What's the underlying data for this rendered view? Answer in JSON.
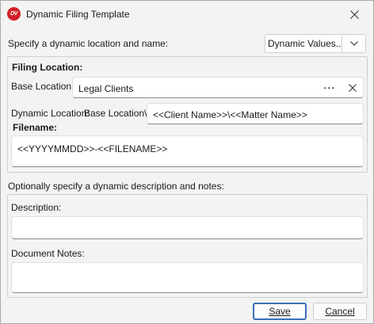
{
  "window": {
    "title": "Dynamic Filing Template",
    "logo_text": "DV"
  },
  "prompt_location": "Specify a dynamic location and name:",
  "dynamic_values": {
    "label": "Dynamic Values...."
  },
  "filing": {
    "heading": "Filing Location:",
    "base_location_label": "Base Location:",
    "base_location_value": "Legal Clients",
    "more_icon_glyph": "···",
    "dynamic_location_label": "Dynamic Location:",
    "dynamic_location_prefix": "Base Location\\",
    "dynamic_location_value": "<<Client Name>>\\<<Matter Name>>",
    "filename_heading": "Filename:",
    "filename_value": "<<YYYYMMDD>>-<<FILENAME>>"
  },
  "prompt_notes": "Optionally specify a dynamic description and notes:",
  "notes": {
    "description_label": "Description:",
    "description_value": "",
    "document_notes_label": "Document Notes:",
    "document_notes_value": ""
  },
  "buttons": {
    "save": "Save",
    "cancel": "Cancel"
  },
  "colors": {
    "logo_red": "#d32027",
    "primary_border": "#3a6fb5"
  },
  "icons": [
    "close-icon",
    "chevron-down-icon",
    "ellipsis-icon",
    "clear-icon"
  ]
}
